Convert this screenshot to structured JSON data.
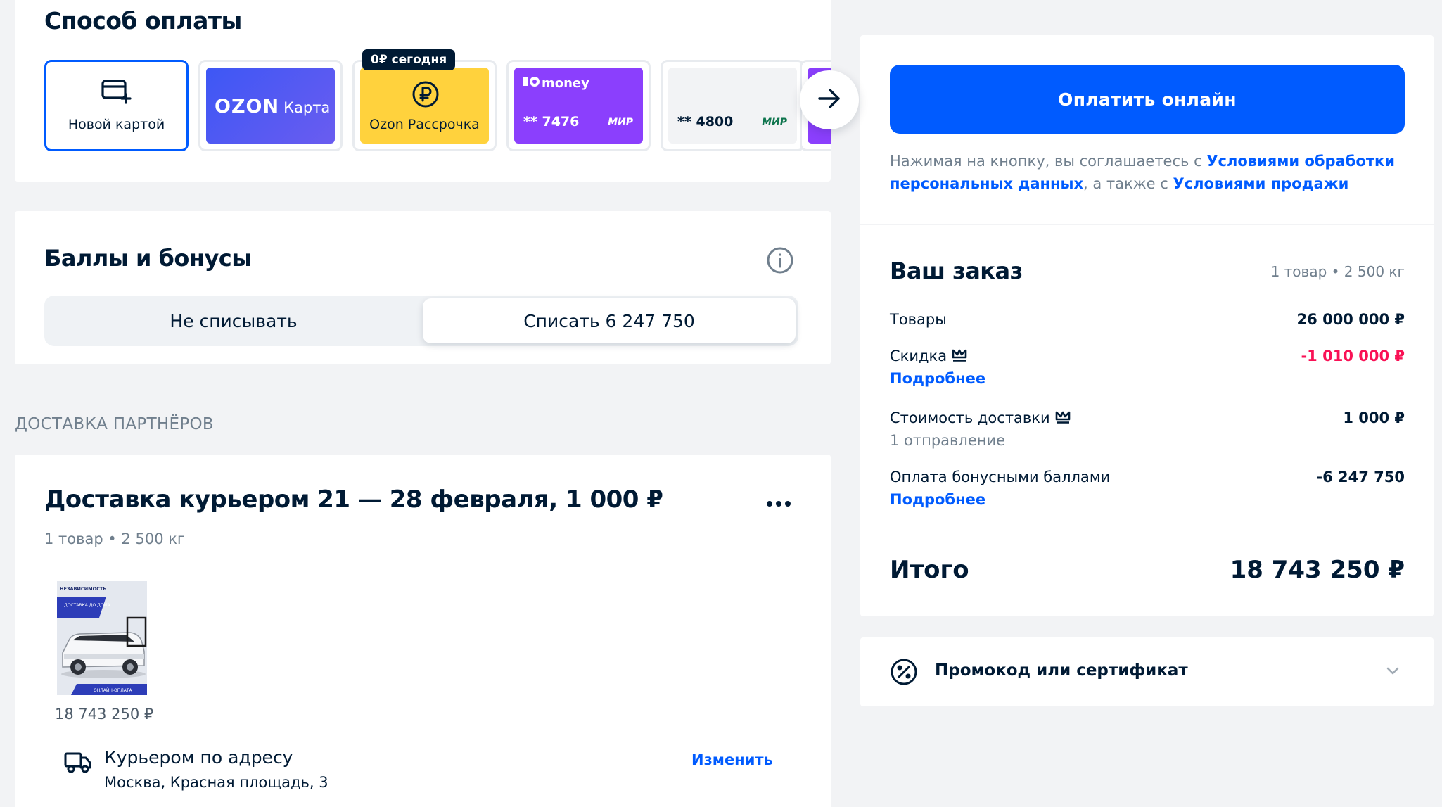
{
  "payment": {
    "title": "Способ оплаты",
    "badge_today": "0₽ сегодня",
    "cards": {
      "new_card": "Новой картой",
      "ozon_brand": "OZON",
      "ozon_card": "Карта",
      "installment": "Ozon Рассрочка",
      "money_brand": "money",
      "money_number": "** 7476",
      "money_network": "МИР",
      "card_number": "** 4800",
      "card_network": "МИР"
    },
    "icons": [
      "card-plus-icon",
      "ruble-coin-icon",
      "arrow-right-icon"
    ]
  },
  "bonuses": {
    "title": "Баллы и бонусы",
    "options": [
      "Не списывать",
      "Списать 6 247 750"
    ],
    "selected": "Списать 6 247 750"
  },
  "partners_heading": "ДОСТАВКА ПАРТНЁРОВ",
  "delivery": {
    "title": "Доставка курьером 21 — 28 февраля, 1 000 ₽",
    "meta": "1 товар • 2 500 кг",
    "product_price": "18 743 250 ₽",
    "product_image_text": {
      "top": "НЕЗАВИСИМОСТЬ",
      "mid": "ДОСТАВКА ДО ДОМА",
      "bottom": "ОНЛАЙН-ОПЛАТА"
    },
    "method_title": "Курьером по адресу",
    "address": "Москва, Красная площадь, 3",
    "change_link": "Изменить"
  },
  "checkout": {
    "pay_button": "Оплатить онлайн",
    "consent_prefix": "Нажимая на кнопку, вы соглашаетесь с ",
    "consent_link1": "Условиями обработки персональных данных",
    "consent_middle": ", а также с ",
    "consent_link2": "Условиями продажи"
  },
  "order": {
    "title": "Ваш заказ",
    "meta": "1 товар • 2 500 кг",
    "goods_label": "Товары",
    "goods_value": "26 000 000 ₽",
    "discount_label": "Скидка",
    "discount_value": "-1 010 000 ₽",
    "discount_link": "Подробнее",
    "shipping_label": "Стоимость доставки",
    "shipping_value": "1 000 ₽",
    "shipping_sub": "1 отправление",
    "bonus_label": "Оплата бонусными баллами",
    "bonus_value": "-6 247 750",
    "bonus_link": "Подробнее",
    "total_label": "Итого",
    "total_value": "18 743 250 ₽"
  },
  "promo": {
    "label": "Промокод или сертификат"
  },
  "colors": {
    "accent": "#005bff",
    "text": "#001a34",
    "muted": "#707f8d",
    "discount": "#f91155",
    "installment": "#ffd23d",
    "money": "#8b3ffd",
    "background": "#f2f3f5"
  }
}
